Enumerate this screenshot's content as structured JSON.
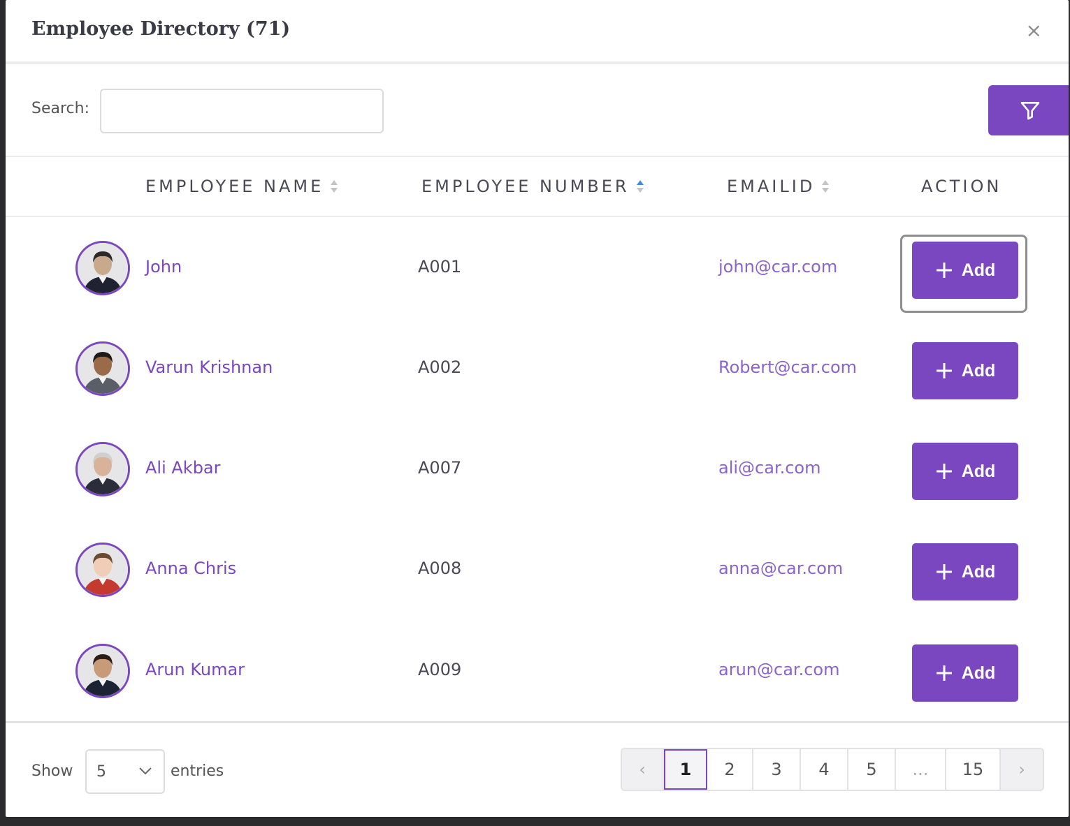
{
  "modal": {
    "title": "Employee Directory (71)",
    "close_label": "×"
  },
  "search": {
    "label": "Search:",
    "value": "",
    "placeholder": ""
  },
  "filter_button": {
    "icon": "filter-icon"
  },
  "table": {
    "headers": [
      {
        "label": "EMPLOYEE NAME",
        "sort": "none"
      },
      {
        "label": "EMPLOYEE NUMBER",
        "sort": "ascending"
      },
      {
        "label": "EMAILID",
        "sort": "none"
      },
      {
        "label": "ACTION",
        "sort": null
      }
    ],
    "rows": [
      {
        "name": "John",
        "number": "A001",
        "email": "john@car.com",
        "action": "Add",
        "avatar_skin": "#c9a98c",
        "avatar_hair": "#2a2a2a",
        "avatar_suit": "#1f2230"
      },
      {
        "name": "Varun Krishnan",
        "number": "A002",
        "email": "Robert@car.com",
        "action": "Add",
        "avatar_skin": "#9a6b48",
        "avatar_hair": "#1b1b1b",
        "avatar_suit": "#5a5e66"
      },
      {
        "name": "Ali Akbar",
        "number": "A007",
        "email": "ali@car.com",
        "action": "Add",
        "avatar_skin": "#d8b39a",
        "avatar_hair": "#cfcfcf",
        "avatar_suit": "#2b2e3a"
      },
      {
        "name": "Anna Chris",
        "number": "A008",
        "email": "anna@car.com",
        "action": "Add",
        "avatar_skin": "#f0cdb6",
        "avatar_hair": "#6b4a32",
        "avatar_suit": "#c43a2e"
      },
      {
        "name": "Arun Kumar",
        "number": "A009",
        "email": "arun@car.com",
        "action": "Add",
        "avatar_skin": "#c79a78",
        "avatar_hair": "#2a1e16",
        "avatar_suit": "#1c2433"
      }
    ]
  },
  "footer": {
    "show_label": "Show",
    "page_size": "5",
    "entries_label": "entries",
    "pagination": {
      "prev": "‹",
      "pages": [
        "1",
        "2",
        "3",
        "4",
        "5",
        "...",
        "15"
      ],
      "current": "1",
      "next": "›"
    }
  },
  "colors": {
    "accent": "#7b47c1",
    "link": "#7b47c1",
    "email": "#8c63cc",
    "sort_active": "#3f8ee6"
  }
}
